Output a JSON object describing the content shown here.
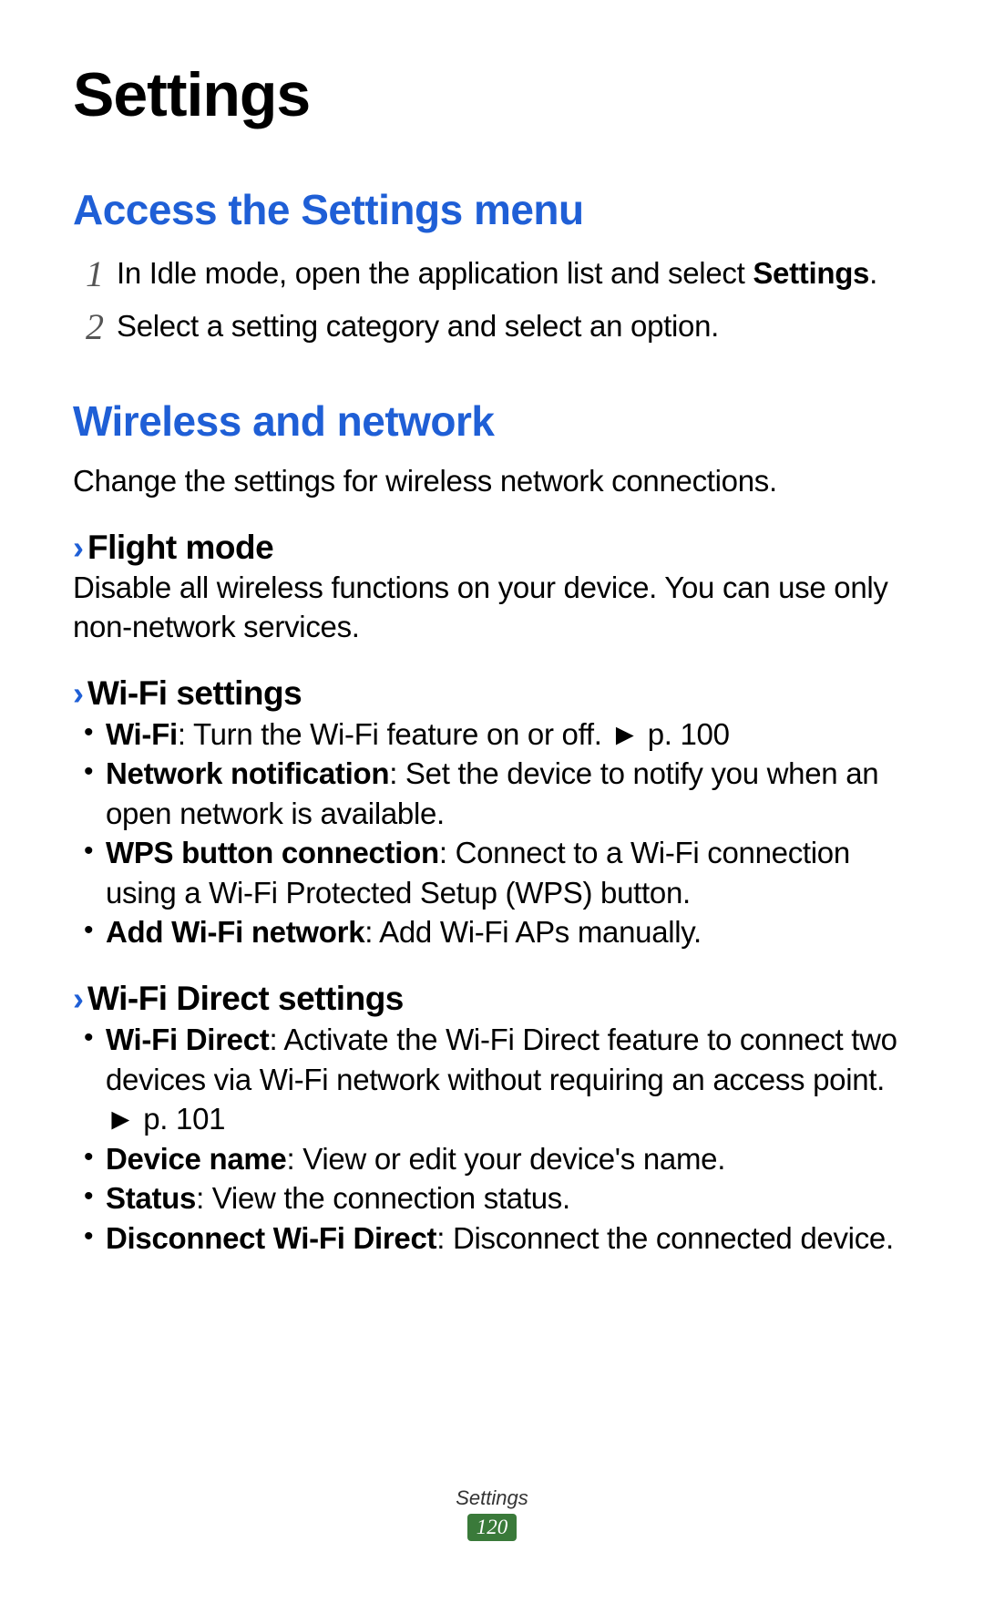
{
  "title": "Settings",
  "section1": {
    "heading": "Access the Settings menu",
    "steps": [
      {
        "num": "1",
        "pre": "In Idle mode, open the application list and select ",
        "bold": "Settings",
        "post": "."
      },
      {
        "num": "2",
        "pre": "Select a setting category and select an option.",
        "bold": "",
        "post": ""
      }
    ]
  },
  "section2": {
    "heading": "Wireless and network",
    "intro": "Change the settings for wireless network connections.",
    "sub1": {
      "title": "Flight mode",
      "text": "Disable all wireless functions on your device. You can use only non-network services."
    },
    "sub2": {
      "title": "Wi-Fi settings",
      "items": [
        {
          "bold": "Wi-Fi",
          "text": ": Turn the Wi-Fi feature on or off. ► p. 100"
        },
        {
          "bold": "Network notification",
          "text": ": Set the device to notify you when an open network is available."
        },
        {
          "bold": "WPS button connection",
          "text": ": Connect to a Wi-Fi connection using a Wi-Fi Protected Setup (WPS) button."
        },
        {
          "bold": "Add Wi-Fi network",
          "text": ": Add Wi-Fi APs manually."
        }
      ]
    },
    "sub3": {
      "title": "Wi-Fi Direct settings",
      "items": [
        {
          "bold": "Wi-Fi Direct",
          "text": ": Activate the Wi-Fi Direct feature to connect two devices via Wi-Fi network without requiring an access point. ► p. 101"
        },
        {
          "bold": "Device name",
          "text": ": View or edit your device's name."
        },
        {
          "bold": "Status",
          "text": ": View the connection status."
        },
        {
          "bold": "Disconnect Wi-Fi Direct",
          "text": ": Disconnect the connected device."
        }
      ]
    }
  },
  "footer": {
    "label": "Settings",
    "page": "120"
  }
}
